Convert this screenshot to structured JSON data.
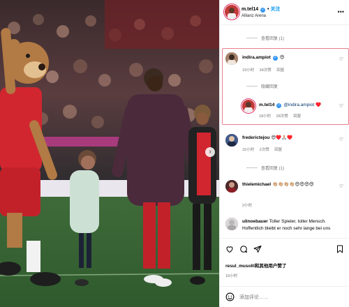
{
  "header": {
    "username": "m.tel14",
    "separator": "•",
    "follow_label": "关注",
    "location": "Allianz Arena",
    "more": "•••"
  },
  "replies_toggle_top": {
    "label": "查看回复 (1)"
  },
  "comments": [
    {
      "username": "indira.ampiot",
      "text": "😍",
      "time": "19小时",
      "likes": "34次赞",
      "reply": "回复",
      "hide_replies": "隐藏回复",
      "replies": [
        {
          "username": "m.tel14",
          "mention": "@indira.ampiot",
          "text": "♥️",
          "time": "18小时",
          "likes": "28次赞",
          "reply": "回复"
        }
      ]
    },
    {
      "username": "frederictejou",
      "text": "😍♥️🙏🏼♥️",
      "time": "15小时",
      "likes": "2次赞",
      "reply": "回复",
      "view_replies": "查看回复 (1)"
    },
    {
      "username": "thielemichael",
      "text": "👏🏼👏🏼👏🏼👏🏼😍😍😍😍",
      "time": "2小时"
    },
    {
      "username": "ulinoebauer",
      "text": "Toller Spieler, toller Mensch. Hoffentlich bleibt er noch sehr lange bei uns"
    }
  ],
  "actions": {
    "like_icon": "heart-outline-icon",
    "comment_icon": "comment-bubble-icon",
    "share_icon": "paper-plane-icon",
    "save_icon": "bookmark-icon"
  },
  "likes_line": "resul_musolli和其他用户赞了",
  "post_time": "19小时",
  "add_comment": {
    "emoji_icon": "smiley-icon",
    "placeholder": "添加评论……"
  },
  "colors": {
    "verified": "#3897f0",
    "follow": "#0095f6",
    "highlight": "#e87f8c",
    "bayern_red": "#d1262f"
  }
}
